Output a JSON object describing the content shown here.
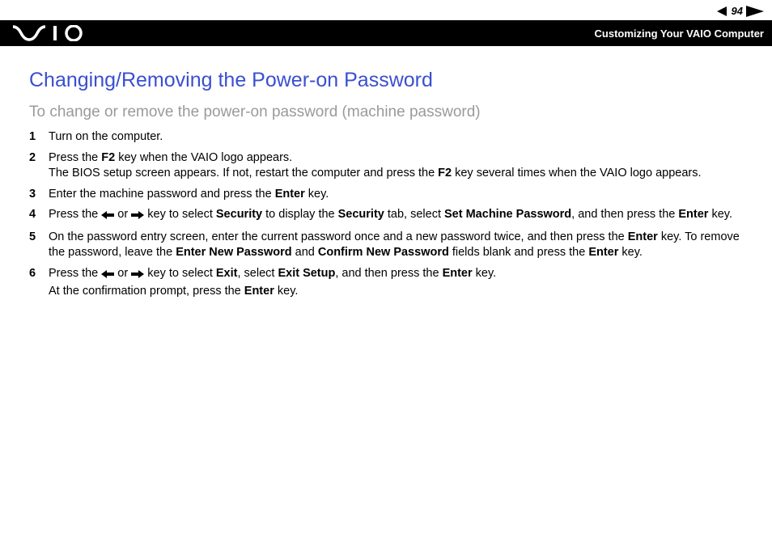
{
  "header": {
    "page_number": "94",
    "section": "Customizing Your VAIO Computer"
  },
  "page": {
    "title": "Changing/Removing the Power-on Password",
    "subtitle": "To change or remove the power-on password (machine password)"
  },
  "steps": [
    {
      "n": "1"
    },
    {
      "n": "2"
    },
    {
      "n": "3"
    },
    {
      "n": "4"
    },
    {
      "n": "5"
    },
    {
      "n": "6"
    }
  ],
  "text": {
    "s1": "Turn on the computer.",
    "s2a": "Press the ",
    "s2_f2": "F2",
    "s2b": " key when the VAIO logo appears.",
    "s2c": "The BIOS setup screen appears. If not, restart the computer and press the ",
    "s2d": " key several times when the VAIO logo appears.",
    "s3a": "Enter the machine password and press the ",
    "s3_enter": "Enter",
    "s3b": " key.",
    "s4a": "Press the ",
    "s4_or": " or ",
    "s4b": " key to select ",
    "s4_sec": "Security",
    "s4c": " to display the ",
    "s4d": " tab, select ",
    "s4_smp": "Set Machine Password",
    "s4e": ", and then press the ",
    "s4f": " key.",
    "s5a": "On the password entry screen, enter the current password once and a new password twice, and then press the ",
    "s5b": " key. To remove the password, leave the ",
    "s5_enp": "Enter New Password",
    "s5_and": " and ",
    "s5_cnp": "Confirm New Password",
    "s5c": " fields blank and press the ",
    "s5d": " key.",
    "s6a": "Press the ",
    "s6b": " key to select ",
    "s6_exit": "Exit",
    "s6c": ", select ",
    "s6_exitsetup": "Exit Setup",
    "s6d": ", and then press the ",
    "s6e": " key.",
    "s6f": "At the confirmation prompt, press the ",
    "s6g": " key."
  }
}
